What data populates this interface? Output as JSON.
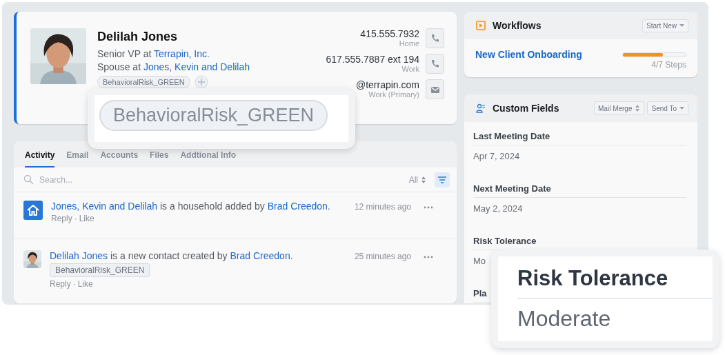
{
  "contact": {
    "name": "Delilah Jones",
    "title_prefix": "Senior VP at",
    "company": "Terrapin, Inc.",
    "relation_prefix": "Spouse at",
    "household": "Jones, Kevin and Delilah",
    "tags": [
      "BehavioralRisk_GREEN"
    ],
    "methods": [
      {
        "kind": "phone",
        "value": "415.555.7932",
        "label": "Home"
      },
      {
        "kind": "phone",
        "value": "617.555.7887 ext 194",
        "label": "Work"
      },
      {
        "kind": "email",
        "value": "@terrapin.com",
        "label": "Work (Primary)"
      }
    ]
  },
  "activity": {
    "tabs": [
      {
        "label": "Activity",
        "selected": true
      },
      {
        "label": "Email",
        "selected": false
      },
      {
        "label": "Accounts",
        "selected": false
      },
      {
        "label": "Files",
        "selected": false
      },
      {
        "label": "Addtional Info",
        "selected": false
      }
    ],
    "search": {
      "placeholder": "Search..."
    },
    "filter": "All",
    "action_separator": "·",
    "items": [
      {
        "kind": "household",
        "subject": "Jones, Kevin and Delilah",
        "text": " is a household added by ",
        "author": "Brad Creedon",
        "end": ".",
        "time": "12 minutes ago",
        "actions": [
          "Reply",
          "Like"
        ]
      },
      {
        "kind": "contact",
        "subject": "Delilah Jones",
        "text": " is a new contact created by ",
        "author": "Brad Creedon",
        "end": ".",
        "time": "25 minutes ago",
        "tags": [
          "BehavioralRisk_GREEN"
        ],
        "actions": [
          "Reply",
          "Like"
        ]
      }
    ]
  },
  "workflows": {
    "title": "Workflows",
    "button": "Start New",
    "items": [
      {
        "name": "New Client Onboarding",
        "level": 0.64,
        "steps": "4/7 Steps"
      }
    ]
  },
  "custom_fields": {
    "title": "Custom Fields",
    "buttons": [
      {
        "label": "Mail Merge",
        "kind": "sort"
      },
      {
        "label": "Send To",
        "kind": "dropdown"
      }
    ],
    "fields": [
      {
        "label": "Last Meeting Date",
        "value": "Apr 7, 2024"
      },
      {
        "label": "Next Meeting Date",
        "value": "May 2, 2024"
      },
      {
        "label": "Risk Tolerance",
        "value": "Mo"
      },
      {
        "label": "Pla"
      }
    ]
  },
  "callouts": [
    {
      "kind": "tag",
      "text": "BehavioralRisk_GREEN"
    },
    {
      "kind": "field",
      "label": "Risk Tolerance",
      "value": "Moderate"
    }
  ]
}
